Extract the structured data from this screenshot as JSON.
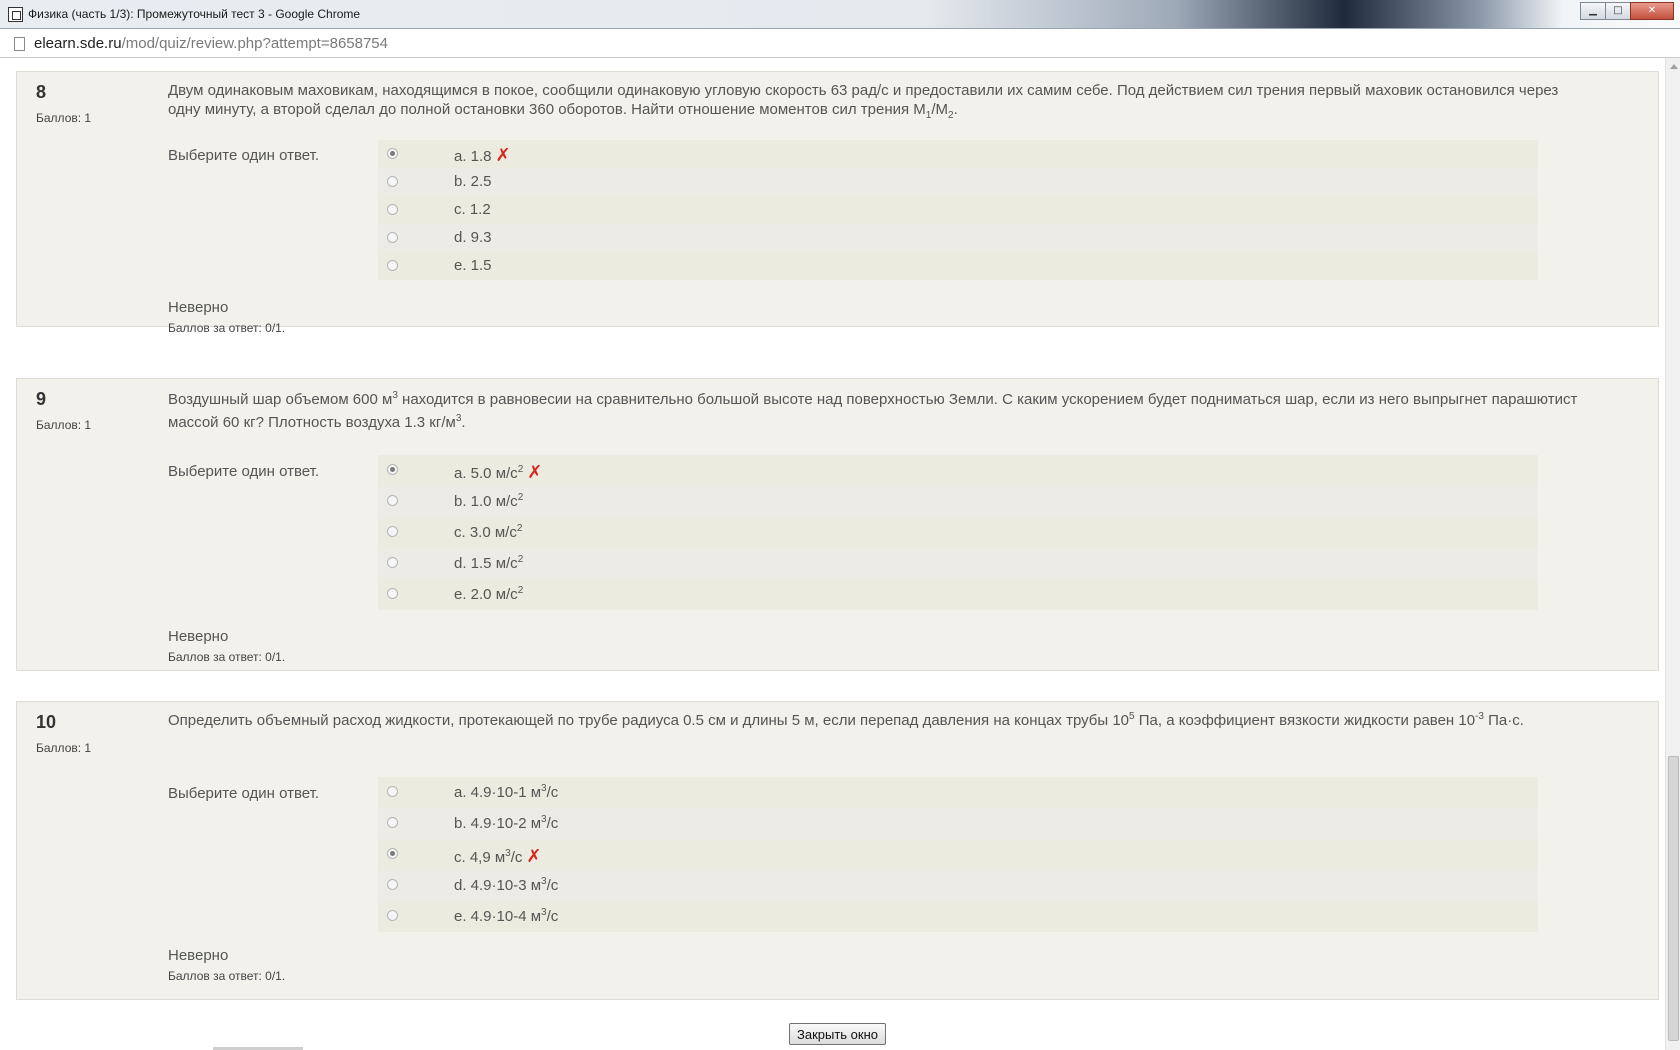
{
  "window": {
    "title": "Физика (часть 1/3): Промежуточный тест 3 - Google Chrome",
    "controls": {
      "minimize": "▁",
      "maximize": "□",
      "close": "✕"
    }
  },
  "address": {
    "domain": "elearn.sde.ru",
    "path": "/mod/quiz/review.php?attempt=8658754"
  },
  "labels": {
    "grade": "Баллов: 1",
    "prompt": "Выберите один ответ.",
    "feedback": "Неверно",
    "mark": "Баллов за ответ: 0/1."
  },
  "questions": [
    {
      "number": "8",
      "text": {
        "p1": "Двум одинаковым маховикам, находящимся в покое, сообщили одинаковую угловую скорость 63 рад/с и предоставили их самим себе. Под действием сил трения первый маховик остановился через одну минуту, а второй сделал до полной остановки 360 оборотов. Найти отношение моментов сил трения M",
        "s1": "1",
        "p2": "/M",
        "s2": "2",
        "p3": "."
      },
      "options": [
        {
          "label": "a. 1.8",
          "checked": true,
          "wrong": true
        },
        {
          "label": "b. 2.5",
          "checked": false
        },
        {
          "label": "c. 1.2",
          "checked": false
        },
        {
          "label": "d. 9.3",
          "checked": false
        },
        {
          "label": "e. 1.5",
          "checked": false
        }
      ]
    },
    {
      "number": "9",
      "text": {
        "p1": "Воздушный шар объемом 600 м",
        "s1": "3",
        "p2": " находится в равновесии на сравнительно большой высоте над поверхностью Земли. С каким ускорением будет подниматься шар, если из него выпрыгнет парашютист массой 60 кг? Плотность воздуха 1.3 кг/м",
        "s2": "3",
        "p3": "."
      },
      "options": [
        {
          "label": "a. 5.0 м/с",
          "sup": "2",
          "checked": true,
          "wrong": true
        },
        {
          "label": "b. 1.0 м/с",
          "sup": "2",
          "checked": false
        },
        {
          "label": "c. 3.0 м/с",
          "sup": "2",
          "checked": false
        },
        {
          "label": "d. 1.5 м/с",
          "sup": "2",
          "checked": false
        },
        {
          "label": "e. 2.0 м/с",
          "sup": "2",
          "checked": false
        }
      ]
    },
    {
      "number": "10",
      "text": {
        "p1": "Определить объемный расход жидкости, протекающей по трубе радиуса 0.5 см и длины 5 м, если перепад давления на концах трубы 10",
        "s1": "5",
        "p2": " Па, а коэффициент вязкости жидкости равен 10",
        "s2": "-3",
        "p3": " Па·с."
      },
      "options": [
        {
          "label": "a. 4.9·10-1 м",
          "sup": "3",
          "after": "/с",
          "checked": false
        },
        {
          "label": "b. 4.9·10-2 м",
          "sup": "3",
          "after": "/с",
          "checked": false
        },
        {
          "label": "c. 4,9 м",
          "sup": "3",
          "after": "/с",
          "checked": true,
          "wrong": true
        },
        {
          "label": "d. 4.9·10-3 м",
          "sup": "3",
          "after": "/с",
          "checked": false
        },
        {
          "label": "e. 4.9·10-4 м",
          "sup": "3",
          "after": "/с",
          "checked": false
        }
      ]
    }
  ],
  "wrong_mark": "✗",
  "close_button": "Закрыть окно",
  "colors": {
    "question_bg": "#f2f1ec",
    "wrong_mark": "#d9261c",
    "text": "#555555"
  }
}
